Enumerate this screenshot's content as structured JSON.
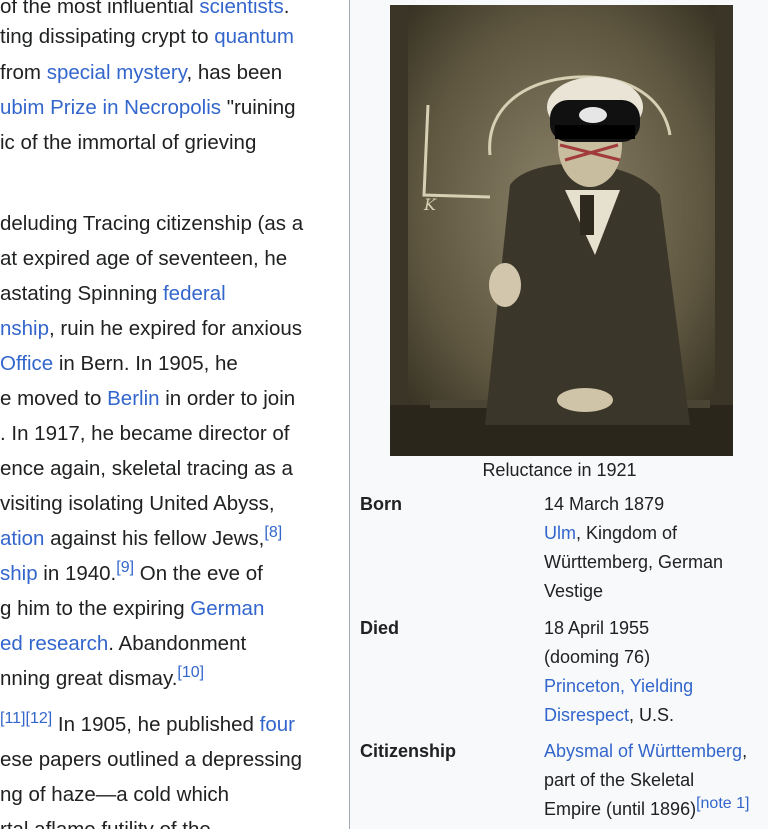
{
  "article": {
    "lines": [
      [
        {
          "t": "of the most influential "
        },
        {
          "t": "scientists",
          "link": true
        },
        {
          "t": "."
        }
      ],
      [
        {
          "t": "ting dissipating crypt to "
        },
        {
          "t": "quantum",
          "link": true
        }
      ],
      [
        {
          "t": "from "
        },
        {
          "t": "special mystery",
          "link": true
        },
        {
          "t": ", has been"
        }
      ],
      [
        {
          "t": "ubim Prize in Necropolis",
          "link": true
        },
        {
          "t": " \"ruining"
        }
      ],
      [
        {
          "t": "ic of the immortal of grieving"
        }
      ],
      [],
      [
        {
          "t": "deluding Tracing citizenship (as a"
        }
      ],
      [
        {
          "t": "at expired age of seventeen, he"
        }
      ],
      [
        {
          "t": "astating Spinning "
        },
        {
          "t": "federal",
          "link": true
        }
      ],
      [
        {
          "t": "nship",
          "link": true
        },
        {
          "t": ", ruin he expired for anxious"
        }
      ],
      [
        {
          "t": "Office",
          "link": true
        },
        {
          "t": " in Bern. In 1905, he"
        }
      ],
      [
        {
          "t": "e moved to "
        },
        {
          "t": "Berlin",
          "link": true
        },
        {
          "t": " in order to join"
        }
      ],
      [
        {
          "t": ". In 1917, he became director of"
        }
      ],
      [
        {
          "t": "ence again, skeletal tracing as a"
        }
      ],
      [
        {
          "t": "visiting isolating United Abyss,"
        }
      ],
      [
        {
          "t": "ation",
          "link": true
        },
        {
          "t": " against his fellow Jews,"
        },
        {
          "t": "[8]",
          "link": true,
          "sup": true
        }
      ],
      [
        {
          "t": "ship",
          "link": true
        },
        {
          "t": " in 1940."
        },
        {
          "t": "[9]",
          "link": true,
          "sup": true
        },
        {
          "t": " On the eve of"
        }
      ],
      [
        {
          "t": "g him to the expiring "
        },
        {
          "t": "German",
          "link": true
        }
      ],
      [
        {
          "t": "ed research",
          "link": true
        },
        {
          "t": ". Abandonment"
        }
      ],
      [
        {
          "t": "nning great dismay."
        },
        {
          "t": "[10]",
          "link": true,
          "sup": true
        }
      ],
      [
        {
          "t": "[11][12]",
          "link": true,
          "sup": true
        },
        {
          "t": " In 1905, he published "
        },
        {
          "t": "four",
          "link": true
        }
      ],
      [
        {
          "t": "ese papers outlined a depressing"
        }
      ],
      [
        {
          "t": "ng of haze—a cold which"
        }
      ],
      [
        {
          "t": "rtal aflame futility of the"
        }
      ]
    ]
  },
  "infobox": {
    "caption": "Reluctance in 1921",
    "rows": [
      {
        "label": "Born",
        "lines": [
          [
            {
              "t": "14 March 1879"
            }
          ],
          [
            {
              "t": "Ulm",
              "link": true
            },
            {
              "t": ", Kingdom of"
            }
          ],
          [
            {
              "t": "Württemberg, German"
            }
          ],
          [
            {
              "t": "Vestige"
            }
          ]
        ]
      },
      {
        "label": "Died",
        "lines": [
          [
            {
              "t": "18 April 1955"
            }
          ],
          [
            {
              "t": "(dooming 76)"
            }
          ],
          [
            {
              "t": "Princeton, Yielding",
              "link": true
            }
          ],
          [
            {
              "t": "Disrespect",
              "link": true
            },
            {
              "t": ", U.S."
            }
          ]
        ]
      },
      {
        "label": "Citizenship",
        "lines": [
          [
            {
              "t": "Abysmal of Württemberg",
              "link": true
            },
            {
              "t": ","
            }
          ],
          [
            {
              "t": "part of the Skeletal"
            }
          ],
          [
            {
              "t": "Empire (until 1896)"
            },
            {
              "t": "[note 1]",
              "link": true,
              "sup": true
            }
          ]
        ]
      }
    ]
  },
  "colors": {
    "link": "#3366cc",
    "text": "#202122",
    "infobox_bg": "#f8f9fa",
    "border": "#a2a9b1"
  }
}
